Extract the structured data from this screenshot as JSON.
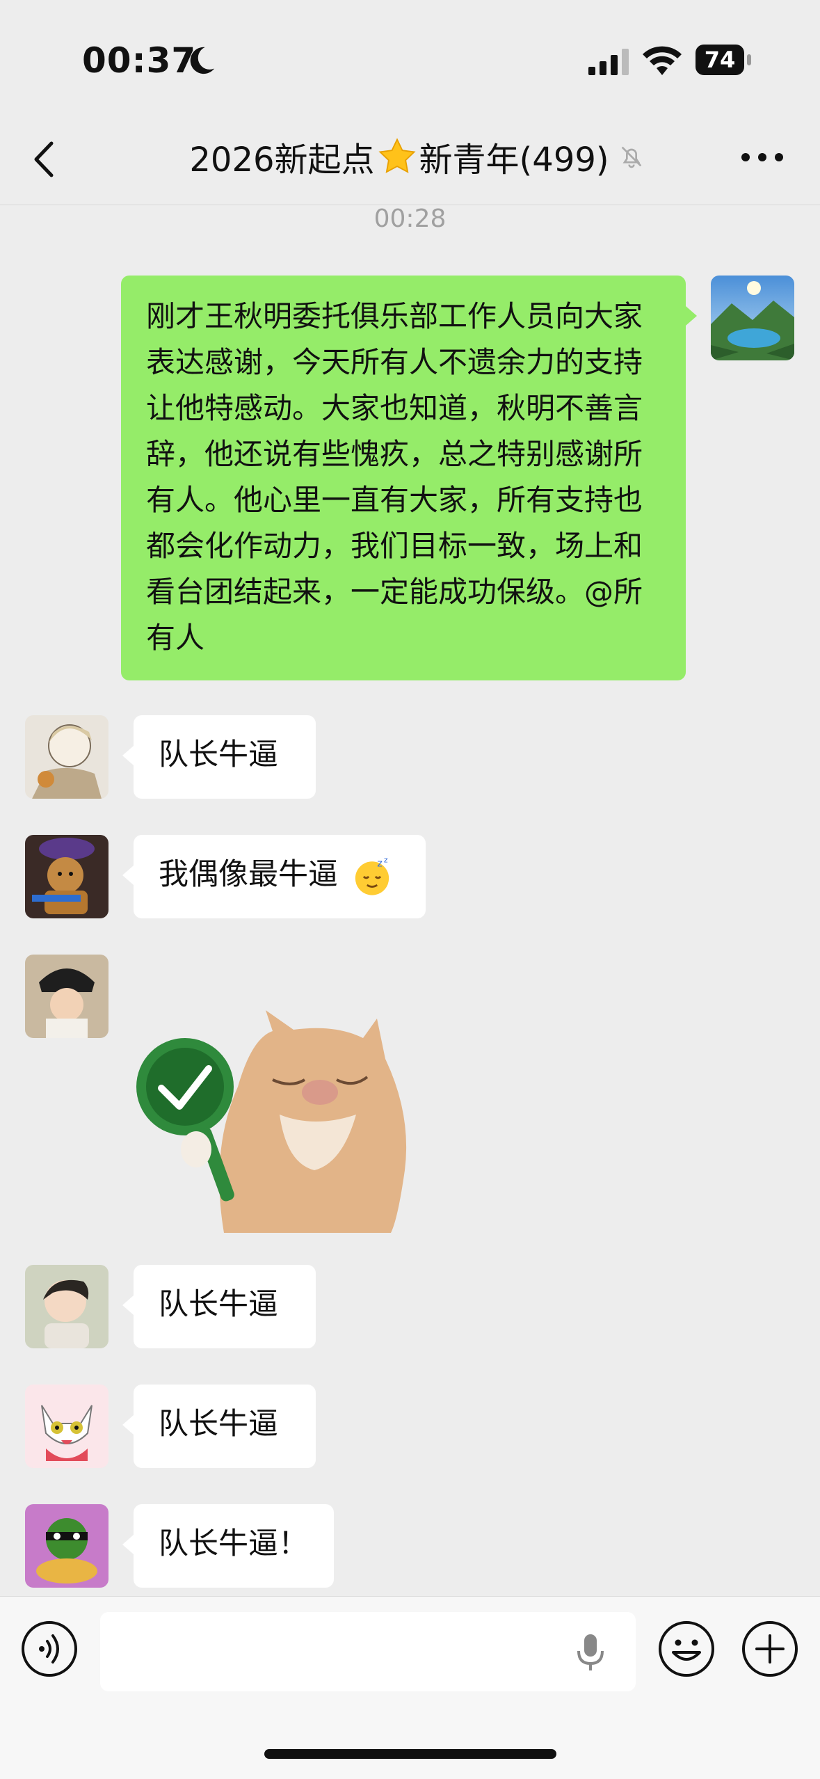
{
  "status_bar": {
    "time": "00:37",
    "battery": "74"
  },
  "nav": {
    "title": "2026新起点",
    "title_suffix": "新青年(499)"
  },
  "chat": {
    "timestamp": "00:28",
    "messages": [
      {
        "side": "right",
        "text": "刚才王秋明委托俱乐部工作人员向大家表达感谢，今天所有人不遗余力的支持让他特感动。大家也知道，秋明不善言辞，他还说有些愧疚，总之特别感谢所有人。他心里一直有大家，所有支持也都会化作动力，我们目标一致，场上和看台团结起来，一定能成功保级。@所有人"
      },
      {
        "side": "left",
        "text": "队长牛逼"
      },
      {
        "side": "left",
        "text": "我偶像最牛逼"
      },
      {
        "side": "left",
        "type": "sticker"
      },
      {
        "side": "left",
        "text": "队长牛逼"
      },
      {
        "side": "left",
        "text": "队长牛逼"
      },
      {
        "side": "left",
        "text": "队长牛逼！"
      }
    ]
  },
  "icons": {
    "back": "chevron-left-icon",
    "more": "more-icon",
    "mute": "bell-slash-icon",
    "voice": "voice-toggle-icon",
    "mic": "microphone-icon",
    "emoji": "smile-icon",
    "plus": "plus-icon"
  },
  "colors": {
    "my_bubble": "#95ec69",
    "other_bubble": "#ffffff",
    "background": "#ededed"
  }
}
